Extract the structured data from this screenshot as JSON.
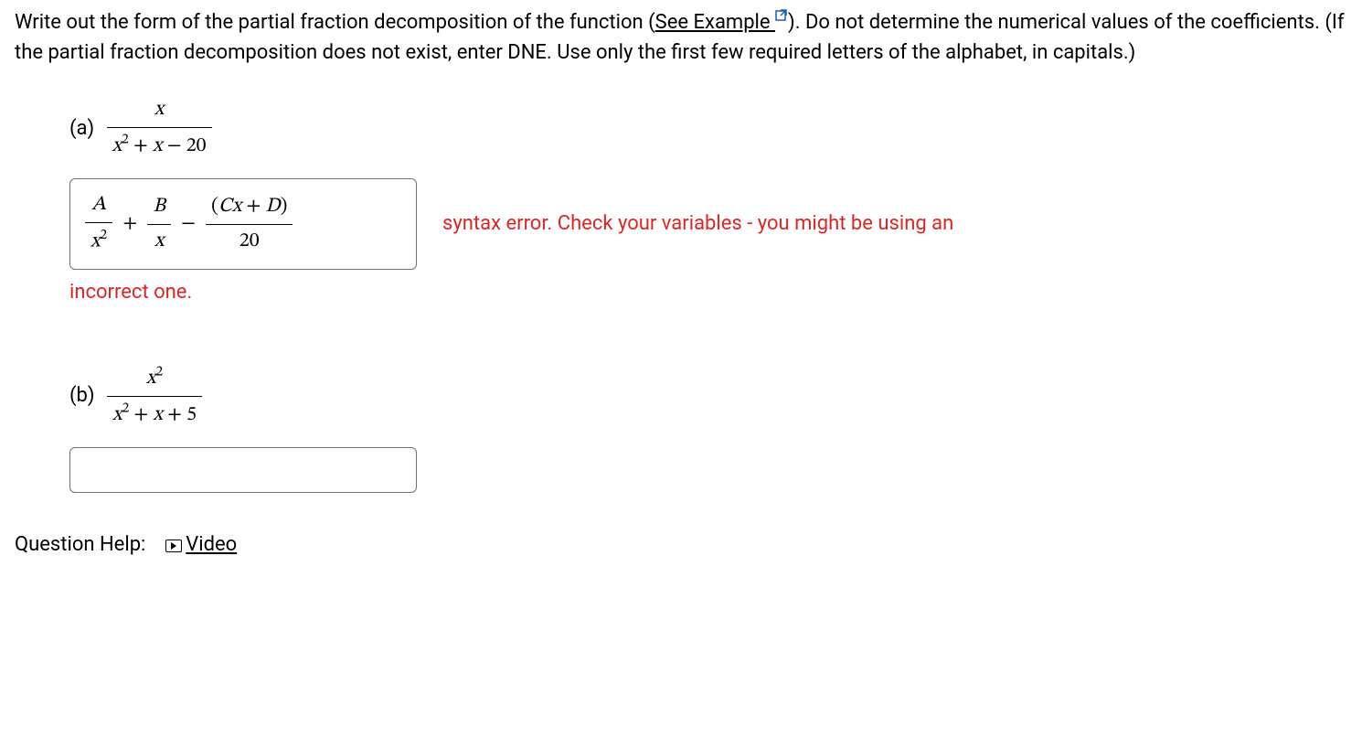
{
  "question": {
    "prefix": "Write out the form of the partial fraction decomposition of the function (",
    "link_text": "See Example",
    "suffix": "). Do not determine the numerical values of the coefficients. (If the partial fraction decomposition does not exist, enter DNE. Use only the first few required letters of the alphabet, in capitals.)"
  },
  "part_a": {
    "label": "(a)",
    "numerator": "x",
    "denominator": "x² + x − 20",
    "answer": {
      "term1_num": "A",
      "term1_den": "x²",
      "op1": "+",
      "term2_num": "B",
      "term2_den": "x",
      "op2": "−",
      "term3_num": "(Cx + D)",
      "term3_den": "20"
    },
    "feedback_line1": "syntax error. Check your variables - you might be using an",
    "feedback_line2": "incorrect one."
  },
  "part_b": {
    "label": "(b)",
    "numerator": "x²",
    "denominator": "x² + x + 5"
  },
  "help": {
    "label": "Question Help:",
    "video": "Video"
  }
}
